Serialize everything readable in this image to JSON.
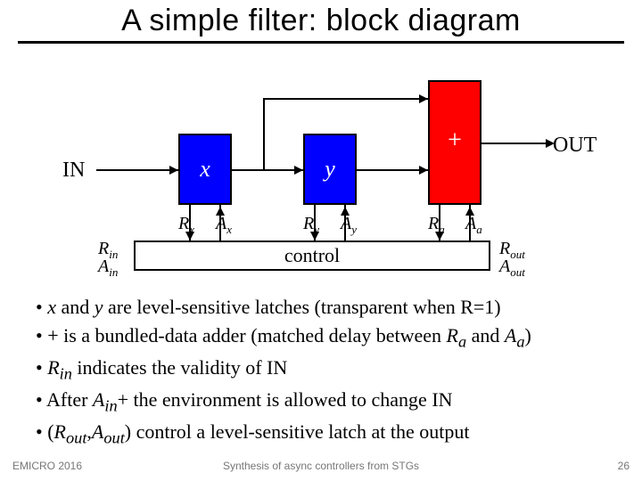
{
  "title": "A simple filter: block diagram",
  "labels": {
    "in": "IN",
    "out": "OUT",
    "x": "x",
    "y": "y",
    "plus": "+",
    "control": "control"
  },
  "signals": {
    "Rin": "R",
    "Rin_sub": "in",
    "Ain": "A",
    "Ain_sub": "in",
    "Rx": "R",
    "Rx_sub": "x",
    "Ax": "A",
    "Ax_sub": "x",
    "Ry": "R",
    "Ry_sub": "y",
    "Ay": "A",
    "Ay_sub": "y",
    "Ra": "R",
    "Ra_sub": "a",
    "Aa": "A",
    "Aa_sub": "a",
    "Rout": "R",
    "Rout_sub": "out",
    "Aout": "A",
    "Aout_sub": "out"
  },
  "bullets": {
    "b1a": "• ",
    "b1_i1": "x",
    "b1b": " and ",
    "b1_i2": "y",
    "b1c": " are level-sensitive latches (transparent when R=1)",
    "b2a": "• + is a bundled-data adder (matched delay between ",
    "b2_i1": "R",
    "b2_i1s": "a",
    "b2b": " and ",
    "b2_i2": "A",
    "b2_i2s": "a",
    "b2c": ")",
    "b3a": "• ",
    "b3_i1": "R",
    "b3_i1s": "in",
    "b3b": " indicates the validity of IN",
    "b4a": "• After  ",
    "b4_i1": "A",
    "b4_i1s": "in",
    "b4b": "+ the environment is allowed to change IN",
    "b5a": "• (",
    "b5_i1": "R",
    "b5_i1s": "out",
    "b5b": ",",
    "b5_i2": "A",
    "b5_i2s": "out",
    "b5c": ") control a level-sensitive latch at the output"
  },
  "footer": {
    "left": "EMICRO 2016",
    "center": "Synthesis of async controllers from STGs",
    "right": "26"
  }
}
